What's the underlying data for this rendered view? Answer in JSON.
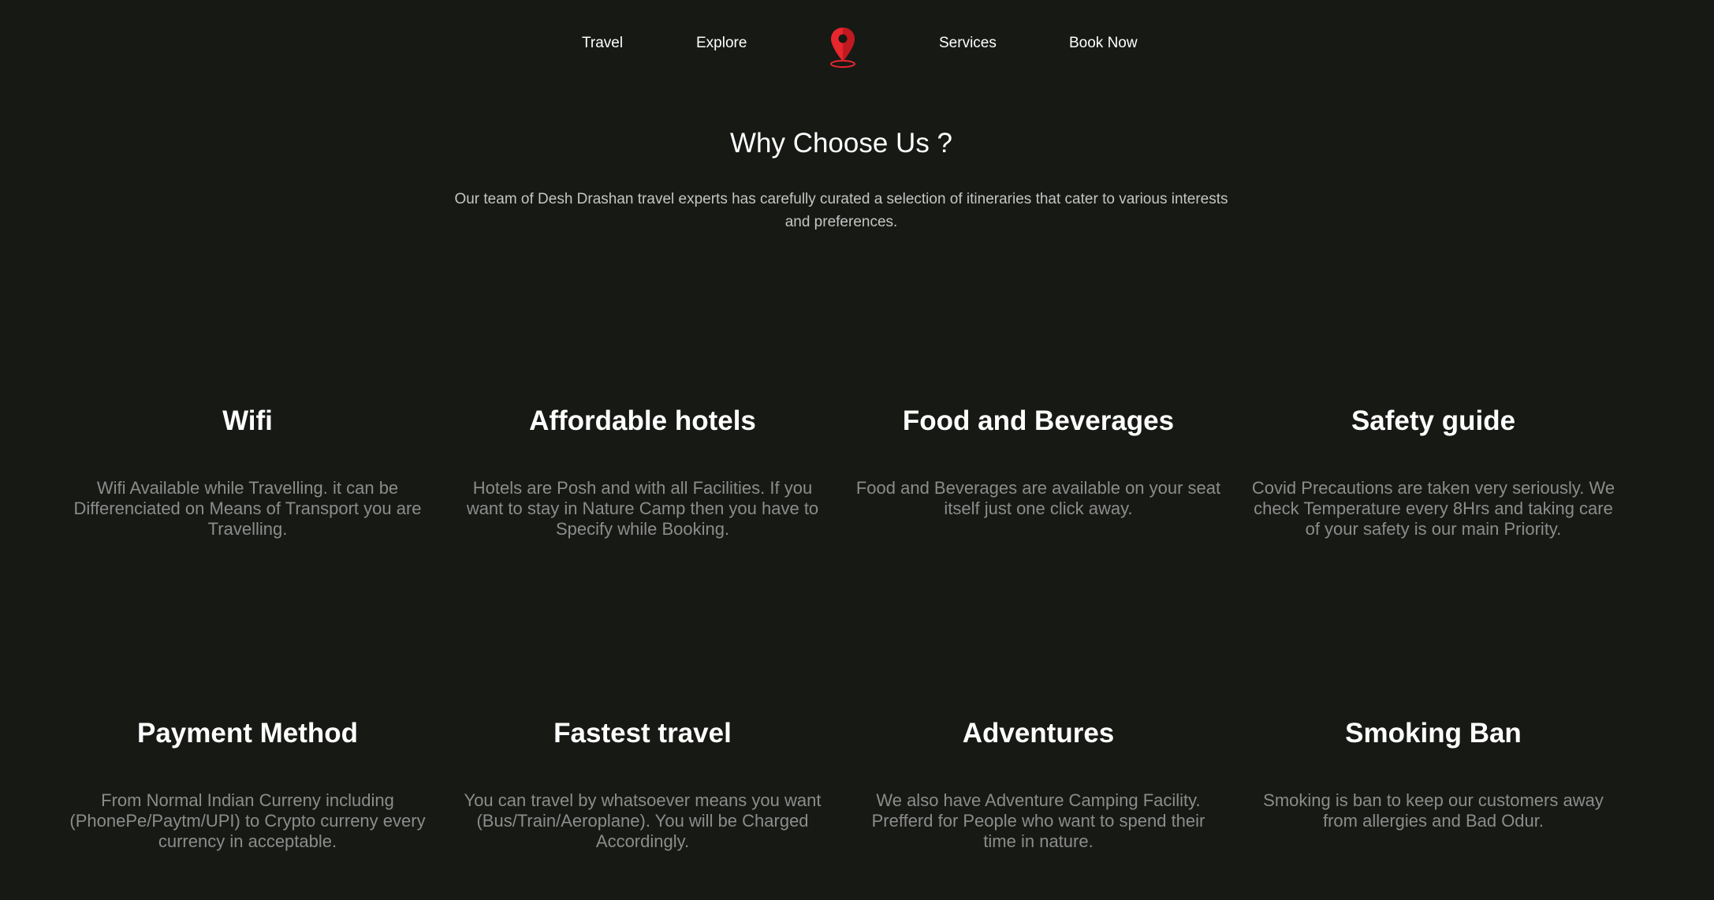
{
  "nav": {
    "links": [
      "Travel",
      "Explore",
      "Services",
      "Book Now"
    ],
    "logo_icon": "map-pin-icon",
    "logo_color": "#e8262d"
  },
  "section": {
    "title": "Why Choose Us ?",
    "intro": "Our team of Desh Drashan travel experts has carefully curated a selection of itineraries that cater to various interests and preferences."
  },
  "features": [
    {
      "title": "Wifi",
      "text": "Wifi Available while Travelling. it can be Differenciated on Means of Transport you are Travelling."
    },
    {
      "title": "Affordable hotels",
      "text": "Hotels are Posh and with all Facilities. If you want to stay in Nature Camp then you have to Specify while Booking."
    },
    {
      "title": "Food and Beverages",
      "text": "Food and Beverages are available on your seat itself just one click away."
    },
    {
      "title": "Safety guide",
      "text": "Covid Precautions are taken very seriously. We check Temperature every 8Hrs and taking care of your safety is our main Priority."
    },
    {
      "title": "Payment Method",
      "text": "From Normal Indian Curreny including (PhonePe/Paytm/UPI) to Crypto curreny every currency in acceptable."
    },
    {
      "title": "Fastest travel",
      "text": "You can travel by whatsoever means you want (Bus/Train/Aeroplane). You will be Charged Accordingly."
    },
    {
      "title": "Adventures",
      "text": "We also have Adventure Camping Facility. Prefferd for People who want to spend their time in nature."
    },
    {
      "title": "Smoking Ban",
      "text": "Smoking is ban to keep our customers away from allergies and Bad Odur."
    }
  ],
  "colors": {
    "background": "#171915",
    "heading": "#ffffff",
    "intro_text": "#c5c5c5",
    "card_text": "#8c8c8c"
  }
}
